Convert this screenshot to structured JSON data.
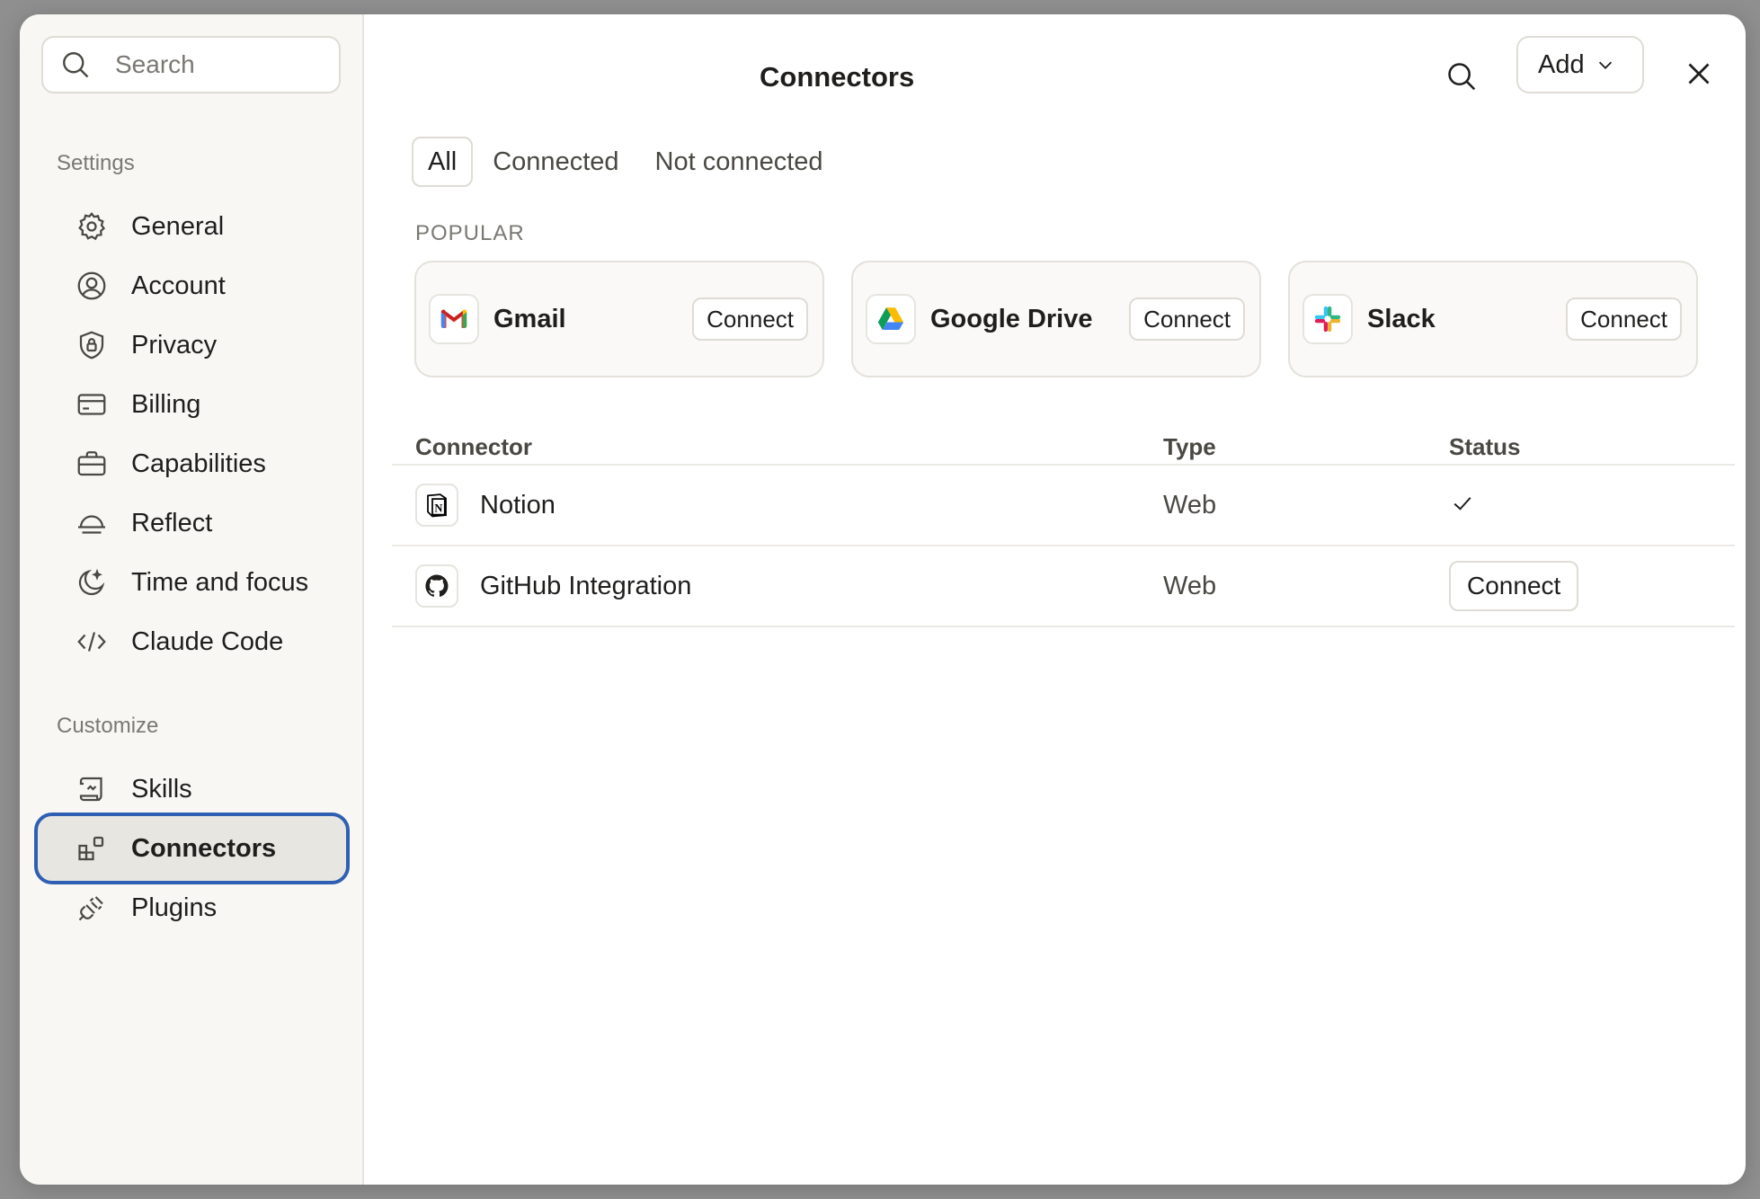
{
  "search": {
    "placeholder": "Search"
  },
  "sidebar": {
    "settings_label": "Settings",
    "settings_items": [
      {
        "label": "General",
        "icon": "gear-icon"
      },
      {
        "label": "Account",
        "icon": "user-circle-icon"
      },
      {
        "label": "Privacy",
        "icon": "shield-lock-icon"
      },
      {
        "label": "Billing",
        "icon": "credit-card-icon"
      },
      {
        "label": "Capabilities",
        "icon": "briefcase-icon"
      },
      {
        "label": "Reflect",
        "icon": "horizon-icon"
      },
      {
        "label": "Time and focus",
        "icon": "moon-icon"
      },
      {
        "label": "Claude Code",
        "icon": "code-icon"
      }
    ],
    "customize_label": "Customize",
    "customize_items": [
      {
        "label": "Skills",
        "icon": "scroll-icon"
      },
      {
        "label": "Connectors",
        "icon": "blocks-icon",
        "active": true
      },
      {
        "label": "Plugins",
        "icon": "plug-icon"
      }
    ]
  },
  "header": {
    "title": "Connectors",
    "add_label": "Add"
  },
  "tabs": [
    {
      "label": "All",
      "active": true
    },
    {
      "label": "Connected"
    },
    {
      "label": "Not connected"
    }
  ],
  "popular": {
    "label": "POPULAR",
    "cards": [
      {
        "name": "Gmail",
        "icon": "gmail-icon",
        "action": "Connect"
      },
      {
        "name": "Google Drive",
        "icon": "google-drive-icon",
        "action": "Connect"
      },
      {
        "name": "Slack",
        "icon": "slack-icon",
        "action": "Connect"
      }
    ]
  },
  "table": {
    "headers": {
      "connector": "Connector",
      "type": "Type",
      "status": "Status"
    },
    "rows": [
      {
        "name": "Notion",
        "icon": "notion-icon",
        "type": "Web",
        "status": "connected"
      },
      {
        "name": "GitHub Integration",
        "icon": "github-icon",
        "type": "Web",
        "status": "Connect"
      }
    ]
  },
  "colors": {
    "focus_ring": "#2f5fb3",
    "sidebar_bg": "#f8f7f4",
    "active_bg": "#e8e6e0"
  }
}
